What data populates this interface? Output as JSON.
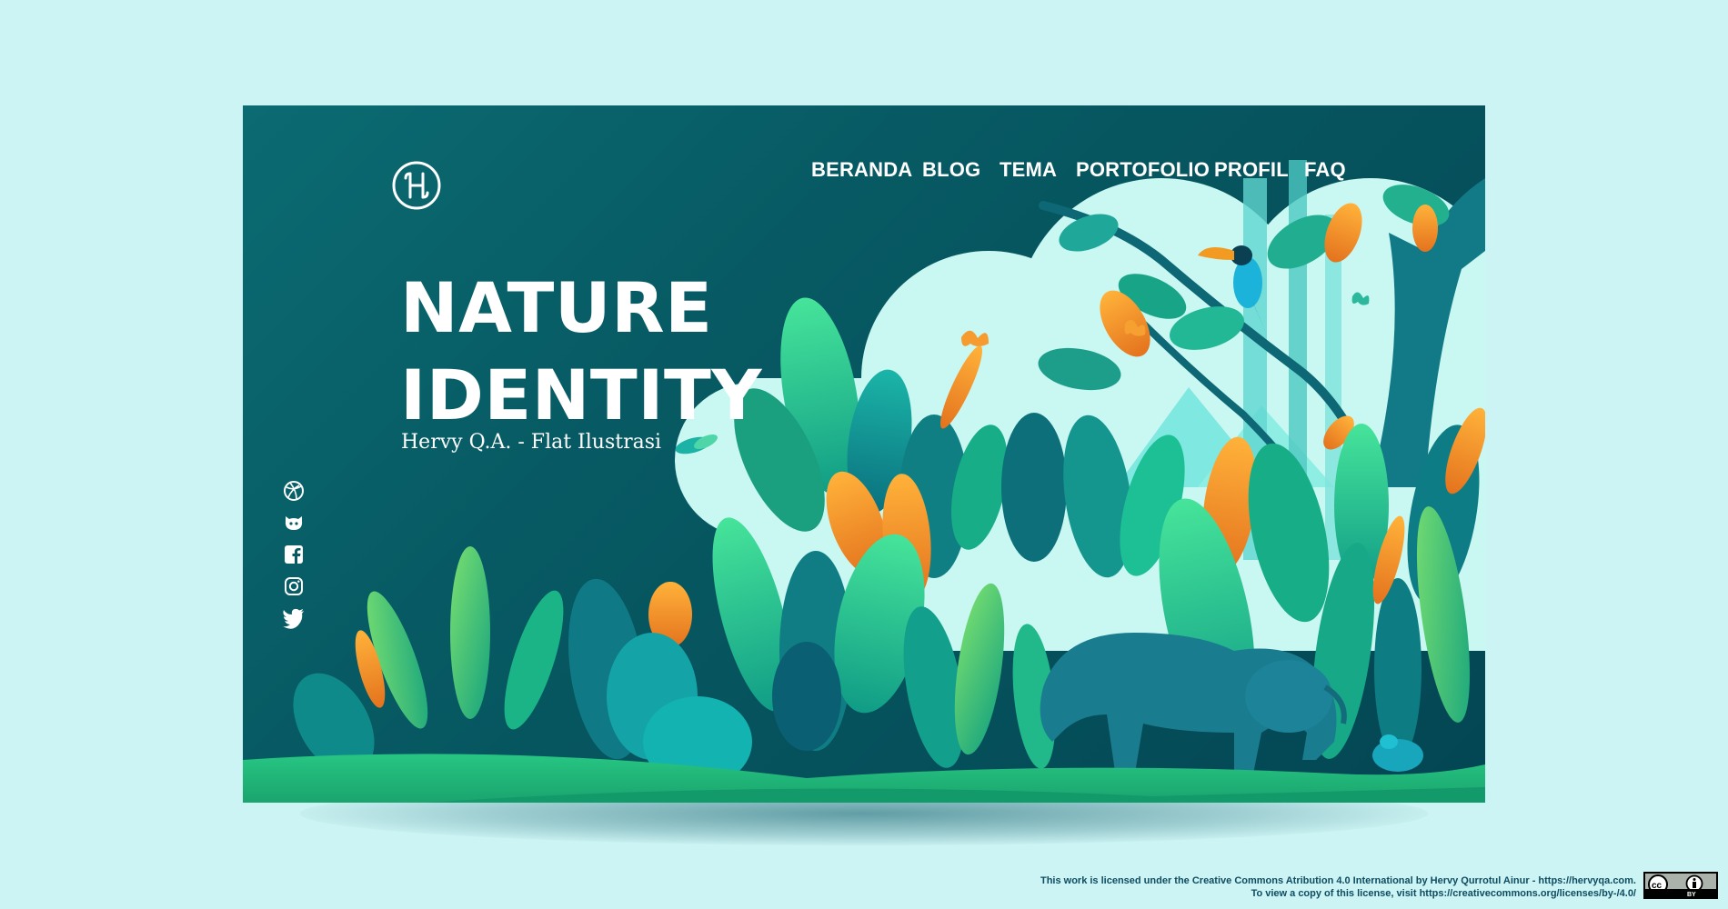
{
  "nav": {
    "items": [
      "BERANDA",
      "BLOG",
      "TEMA",
      "PORTOFOLIO",
      "PROFIL",
      "FAQ"
    ]
  },
  "hero": {
    "title_line1": "NATURE",
    "title_line2": "IDENTITY",
    "subtitle": "Hervy Q.A. - Flat Ilustrasi"
  },
  "social": {
    "icons": [
      "dribbble-icon",
      "github-icon",
      "facebook-icon",
      "instagram-icon",
      "twitter-icon"
    ]
  },
  "license": {
    "line1": "This work is licensed under the Creative Commons Atribution 4.0 International by Hervy Qurrotul Ainur - https://hervyqa.com.",
    "line2": "To view a copy of this license, visit https://creativecommons.org/licenses/by-/4.0/",
    "badge_cc": "cc",
    "badge_by": "BY"
  },
  "colors": {
    "page_bg": "#cdf4f4",
    "card_bg": "#075a63",
    "leaf_green": "#2dd08a",
    "leaf_orange": "#f08a24",
    "sky": "#c9f7f2"
  }
}
